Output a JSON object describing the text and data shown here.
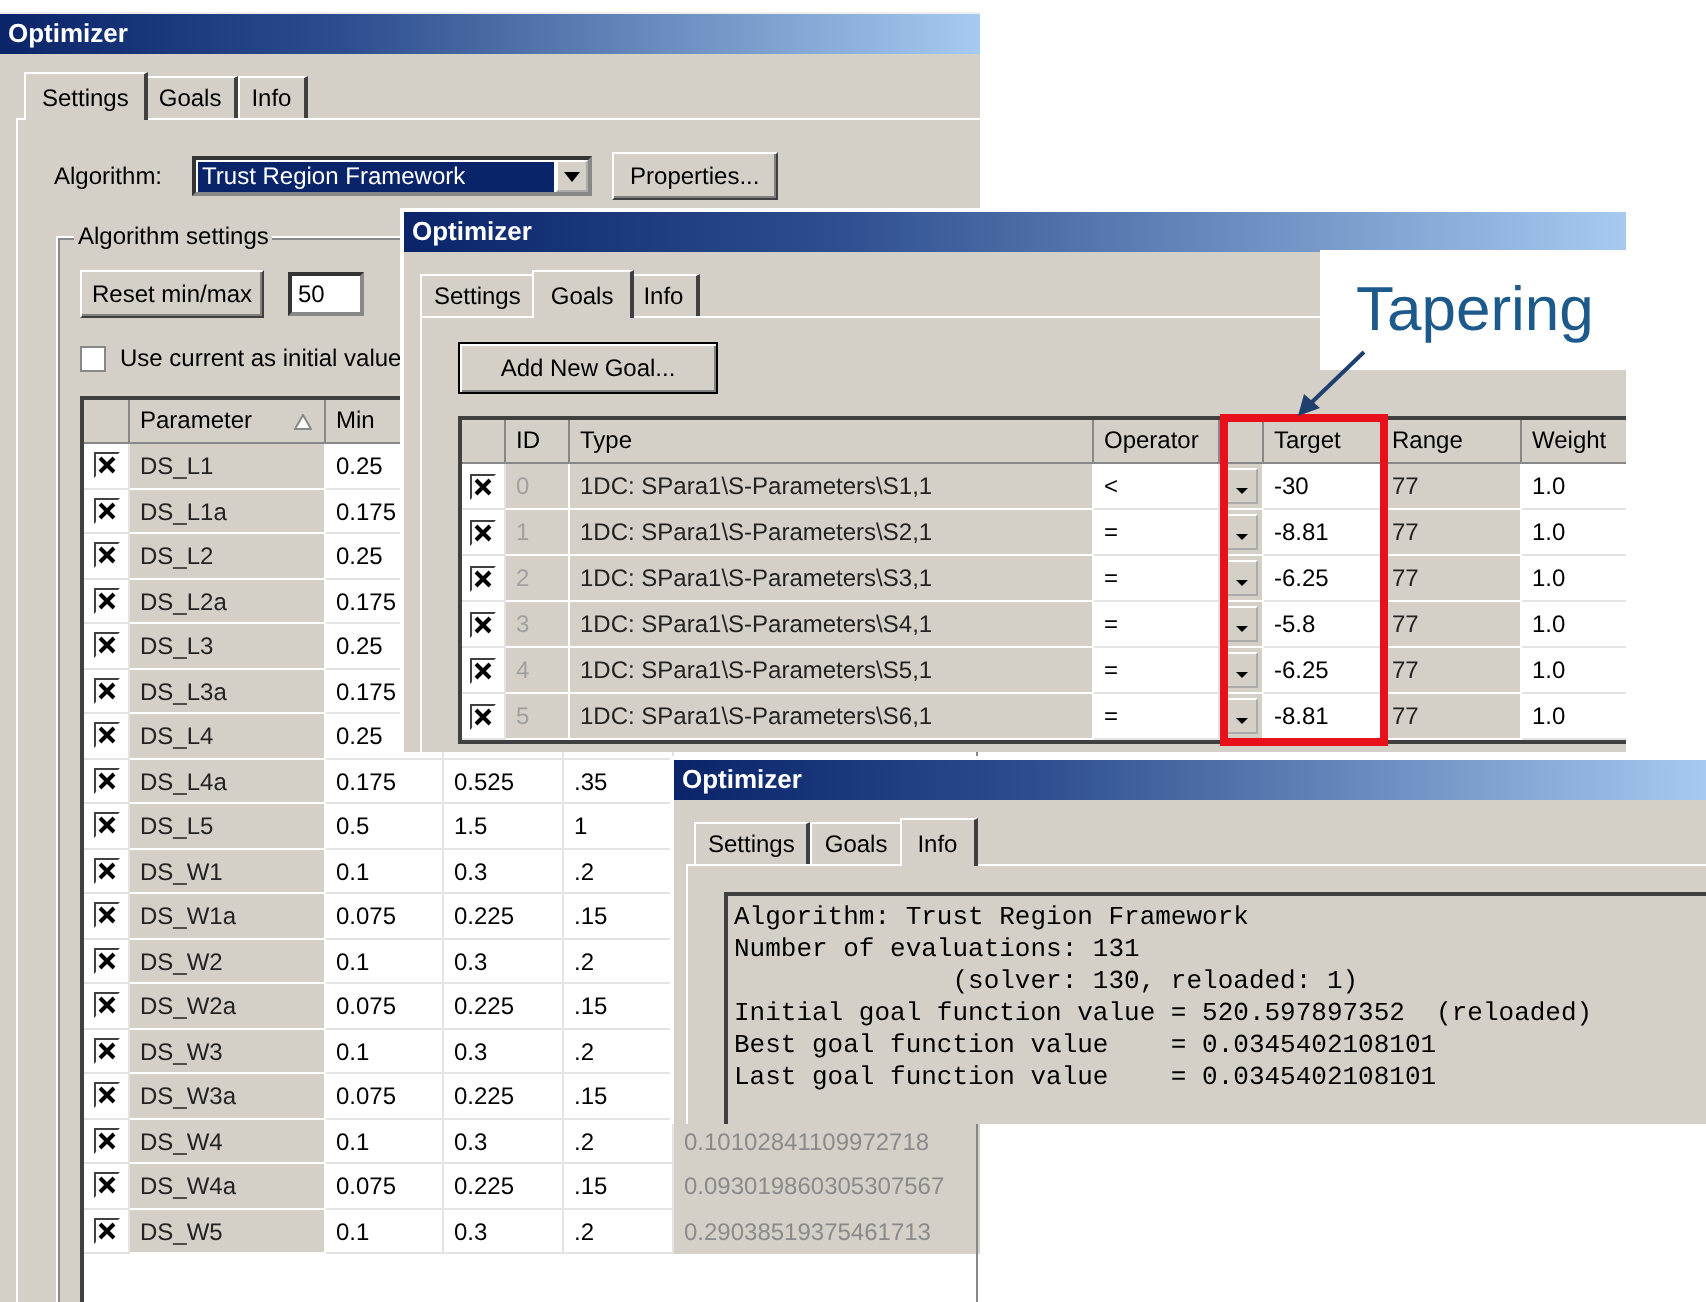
{
  "settings_window": {
    "title": "Optimizer",
    "tabs": [
      {
        "label": "Settings",
        "selected": true
      },
      {
        "label": "Goals",
        "selected": false
      },
      {
        "label": "Info",
        "selected": false
      }
    ],
    "algorithm_label": "Algorithm:",
    "algorithm_value": "Trust Region Framework",
    "properties_button": "Properties...",
    "group_title": "Algorithm settings",
    "reset_button": "Reset min/max",
    "percent_value": "50",
    "use_current": {
      "label": "Use current as initial value",
      "checked": false
    },
    "columns": {
      "parameter": "Parameter",
      "min": "Min"
    },
    "rows": [
      {
        "checked": true,
        "name": "DS_L1",
        "min": "0.25"
      },
      {
        "checked": true,
        "name": "DS_L1a",
        "min": "0.175"
      },
      {
        "checked": true,
        "name": "DS_L2",
        "min": "0.25"
      },
      {
        "checked": true,
        "name": "DS_L2a",
        "min": "0.175"
      },
      {
        "checked": true,
        "name": "DS_L3",
        "min": "0.25"
      },
      {
        "checked": true,
        "name": "DS_L3a",
        "min": "0.175"
      },
      {
        "checked": true,
        "name": "DS_L4",
        "min": "0.25"
      },
      {
        "checked": true,
        "name": "DS_L4a",
        "min": "0.175",
        "column_3": "0.525",
        "column_4": ".35"
      },
      {
        "checked": true,
        "name": "DS_L5",
        "min": "0.5",
        "column_3": "1.5",
        "column_4": "1"
      },
      {
        "checked": true,
        "name": "DS_W1",
        "min": "0.1",
        "column_3": "0.3",
        "column_4": ".2"
      },
      {
        "checked": true,
        "name": "DS_W1a",
        "min": "0.075",
        "column_3": "0.225",
        "column_4": ".15"
      },
      {
        "checked": true,
        "name": "DS_W2",
        "min": "0.1",
        "column_3": "0.3",
        "column_4": ".2"
      },
      {
        "checked": true,
        "name": "DS_W2a",
        "min": "0.075",
        "column_3": "0.225",
        "column_4": ".15"
      },
      {
        "checked": true,
        "name": "DS_W3",
        "min": "0.1",
        "column_3": "0.3",
        "column_4": ".2"
      },
      {
        "checked": true,
        "name": "DS_W3a",
        "min": "0.075",
        "column_3": "0.225",
        "column_4": ".15"
      },
      {
        "checked": true,
        "name": "DS_W4",
        "min": "0.1",
        "column_3": "0.3",
        "column_4": ".2",
        "column_5": "0.10102841109972718"
      },
      {
        "checked": true,
        "name": "DS_W4a",
        "min": "0.075",
        "column_3": "0.225",
        "column_4": ".15",
        "column_5": "0.093019860305307567"
      },
      {
        "checked": true,
        "name": "DS_W5",
        "min": "0.1",
        "column_3": "0.3",
        "column_4": ".2",
        "column_5": "0.29038519375461713"
      }
    ]
  },
  "goals_window": {
    "title": "Optimizer",
    "tabs": [
      {
        "label": "Settings",
        "selected": false
      },
      {
        "label": "Goals",
        "selected": true
      },
      {
        "label": "Info",
        "selected": false
      }
    ],
    "add_button": "Add New Goal...",
    "columns": {
      "id": "ID",
      "type": "Type",
      "operator": "Operator",
      "target": "Target",
      "range": "Range",
      "weight": "Weight"
    },
    "rows": [
      {
        "checked": true,
        "id": "0",
        "type": "1DC: SPara1\\S-Parameters\\S1,1",
        "operator": "<",
        "target": "-30",
        "range": "77",
        "weight": "1.0"
      },
      {
        "checked": true,
        "id": "1",
        "type": "1DC: SPara1\\S-Parameters\\S2,1",
        "operator": "=",
        "target": "-8.81",
        "range": "77",
        "weight": "1.0"
      },
      {
        "checked": true,
        "id": "2",
        "type": "1DC: SPara1\\S-Parameters\\S3,1",
        "operator": "=",
        "target": "-6.25",
        "range": "77",
        "weight": "1.0"
      },
      {
        "checked": true,
        "id": "3",
        "type": "1DC: SPara1\\S-Parameters\\S4,1",
        "operator": "=",
        "target": "-5.8",
        "range": "77",
        "weight": "1.0"
      },
      {
        "checked": true,
        "id": "4",
        "type": "1DC: SPara1\\S-Parameters\\S5,1",
        "operator": "=",
        "target": "-6.25",
        "range": "77",
        "weight": "1.0"
      },
      {
        "checked": true,
        "id": "5",
        "type": "1DC: SPara1\\S-Parameters\\S6,1",
        "operator": "=",
        "target": "-8.81",
        "range": "77",
        "weight": "1.0"
      }
    ],
    "callout": "Tapering"
  },
  "info_window": {
    "title": "Optimizer",
    "tabs": [
      {
        "label": "Settings",
        "selected": false
      },
      {
        "label": "Goals",
        "selected": false
      },
      {
        "label": "Info",
        "selected": true
      }
    ],
    "lines": [
      "Algorithm: Trust Region Framework",
      "Number of evaluations: 131",
      "              (solver: 130, reloaded: 1)",
      "Initial goal function value = 520.597897352  (reloaded)",
      "Best goal function value    = 0.0345402108101",
      "Last goal function value    = 0.0345402108101"
    ]
  }
}
